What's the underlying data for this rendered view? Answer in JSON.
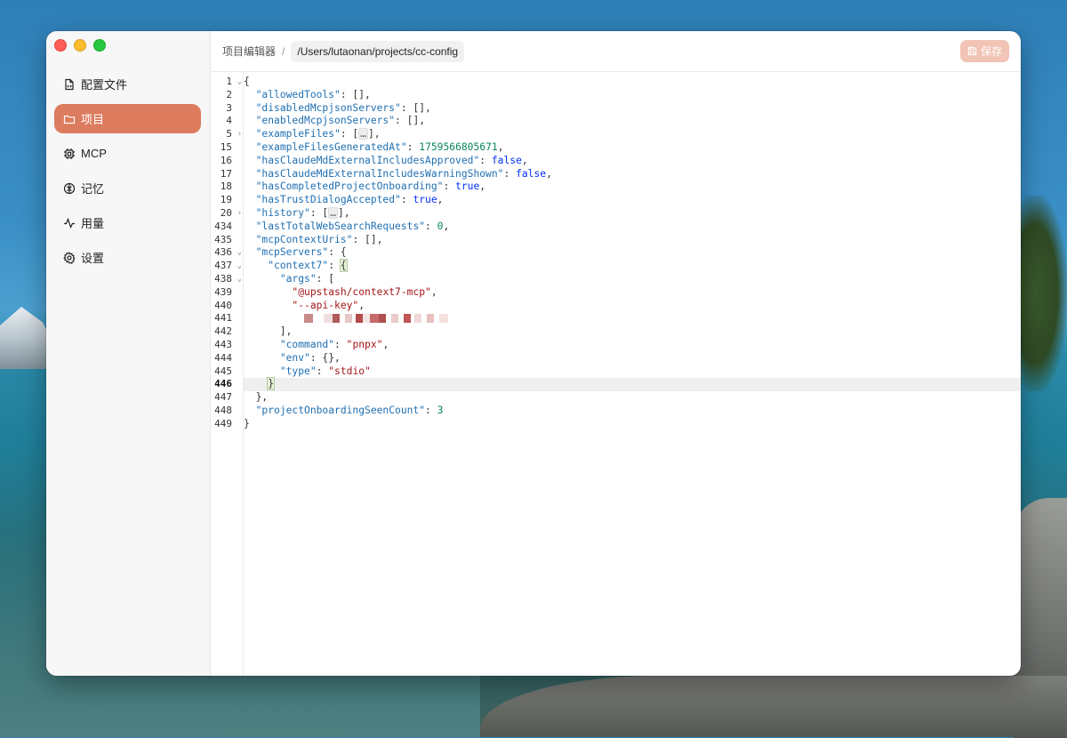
{
  "sidebar": {
    "items": [
      {
        "label": "配置文件",
        "icon": "file-code-icon",
        "active": false
      },
      {
        "label": "项目",
        "icon": "folder-icon",
        "active": true
      },
      {
        "label": "MCP",
        "icon": "chip-icon",
        "active": false
      },
      {
        "label": "记忆",
        "icon": "brain-icon",
        "active": false
      },
      {
        "label": "用量",
        "icon": "activity-icon",
        "active": false
      },
      {
        "label": "设置",
        "icon": "gear-icon",
        "active": false
      }
    ]
  },
  "header": {
    "breadcrumb": "项目编辑器",
    "separator": "/",
    "path": "/Users/lutaonan/projects/cc-config",
    "save_label": "保存"
  },
  "editor": {
    "current_line": "446",
    "lines": [
      {
        "num": "1",
        "fold": "open",
        "tokens": [
          [
            "p",
            "{"
          ]
        ]
      },
      {
        "num": "2",
        "tokens": [
          [
            "p",
            "  "
          ],
          [
            "k",
            "\"allowedTools\""
          ],
          [
            "p",
            ": [],"
          ]
        ]
      },
      {
        "num": "3",
        "tokens": [
          [
            "p",
            "  "
          ],
          [
            "k",
            "\"disabledMcpjsonServers\""
          ],
          [
            "p",
            ": [],"
          ]
        ]
      },
      {
        "num": "4",
        "tokens": [
          [
            "p",
            "  "
          ],
          [
            "k",
            "\"enabledMcpjsonServers\""
          ],
          [
            "p",
            ": [],"
          ]
        ]
      },
      {
        "num": "5",
        "fold": "closed",
        "tokens": [
          [
            "p",
            "  "
          ],
          [
            "k",
            "\"exampleFiles\""
          ],
          [
            "p",
            ": ["
          ],
          [
            "e",
            "…"
          ],
          [
            "p",
            "],"
          ]
        ]
      },
      {
        "num": "15",
        "tokens": [
          [
            "p",
            "  "
          ],
          [
            "k",
            "\"exampleFilesGeneratedAt\""
          ],
          [
            "p",
            ": "
          ],
          [
            "n",
            "1759566805671"
          ],
          [
            "p",
            ","
          ]
        ]
      },
      {
        "num": "16",
        "tokens": [
          [
            "p",
            "  "
          ],
          [
            "k",
            "\"hasClaudeMdExternalIncludesApproved\""
          ],
          [
            "p",
            ": "
          ],
          [
            "b",
            "false"
          ],
          [
            "p",
            ","
          ]
        ]
      },
      {
        "num": "17",
        "tokens": [
          [
            "p",
            "  "
          ],
          [
            "k",
            "\"hasClaudeMdExternalIncludesWarningShown\""
          ],
          [
            "p",
            ": "
          ],
          [
            "b",
            "false"
          ],
          [
            "p",
            ","
          ]
        ]
      },
      {
        "num": "18",
        "tokens": [
          [
            "p",
            "  "
          ],
          [
            "k",
            "\"hasCompletedProjectOnboarding\""
          ],
          [
            "p",
            ": "
          ],
          [
            "b",
            "true"
          ],
          [
            "p",
            ","
          ]
        ]
      },
      {
        "num": "19",
        "tokens": [
          [
            "p",
            "  "
          ],
          [
            "k",
            "\"hasTrustDialogAccepted\""
          ],
          [
            "p",
            ": "
          ],
          [
            "b",
            "true"
          ],
          [
            "p",
            ","
          ]
        ]
      },
      {
        "num": "20",
        "fold": "closed",
        "tokens": [
          [
            "p",
            "  "
          ],
          [
            "k",
            "\"history\""
          ],
          [
            "p",
            ": ["
          ],
          [
            "e",
            "…"
          ],
          [
            "p",
            "],"
          ]
        ]
      },
      {
        "num": "434",
        "tokens": [
          [
            "p",
            "  "
          ],
          [
            "k",
            "\"lastTotalWebSearchRequests\""
          ],
          [
            "p",
            ": "
          ],
          [
            "n",
            "0"
          ],
          [
            "p",
            ","
          ]
        ]
      },
      {
        "num": "435",
        "tokens": [
          [
            "p",
            "  "
          ],
          [
            "k",
            "\"mcpContextUris\""
          ],
          [
            "p",
            ": [],"
          ]
        ]
      },
      {
        "num": "436",
        "fold": "open",
        "tokens": [
          [
            "p",
            "  "
          ],
          [
            "k",
            "\"mcpServers\""
          ],
          [
            "p",
            ": {"
          ]
        ]
      },
      {
        "num": "437",
        "fold": "open",
        "tokens": [
          [
            "p",
            "    "
          ],
          [
            "k",
            "\"context7\""
          ],
          [
            "p",
            ": "
          ],
          [
            "h",
            "{"
          ]
        ]
      },
      {
        "num": "438",
        "fold": "open",
        "tokens": [
          [
            "p",
            "      "
          ],
          [
            "k",
            "\"args\""
          ],
          [
            "p",
            ": ["
          ]
        ]
      },
      {
        "num": "439",
        "tokens": [
          [
            "p",
            "        "
          ],
          [
            "s",
            "\"@upstash/context7-mcp\""
          ],
          [
            "p",
            ","
          ]
        ]
      },
      {
        "num": "440",
        "tokens": [
          [
            "p",
            "        "
          ],
          [
            "s",
            "\"--api-key\""
          ],
          [
            "p",
            ","
          ]
        ]
      },
      {
        "num": "441",
        "tokens": [
          [
            "p",
            "          "
          ],
          [
            "r",
            ""
          ]
        ]
      },
      {
        "num": "442",
        "tokens": [
          [
            "p",
            "      ],"
          ]
        ]
      },
      {
        "num": "443",
        "tokens": [
          [
            "p",
            "      "
          ],
          [
            "k",
            "\"command\""
          ],
          [
            "p",
            ": "
          ],
          [
            "s",
            "\"pnpx\""
          ],
          [
            "p",
            ","
          ]
        ]
      },
      {
        "num": "444",
        "tokens": [
          [
            "p",
            "      "
          ],
          [
            "k",
            "\"env\""
          ],
          [
            "p",
            ": {},"
          ]
        ]
      },
      {
        "num": "445",
        "tokens": [
          [
            "p",
            "      "
          ],
          [
            "k",
            "\"type\""
          ],
          [
            "p",
            ": "
          ],
          [
            "s",
            "\"stdio\""
          ]
        ]
      },
      {
        "num": "446",
        "tokens": [
          [
            "p",
            "    "
          ],
          [
            "h",
            "}"
          ]
        ]
      },
      {
        "num": "447",
        "tokens": [
          [
            "p",
            "  },"
          ]
        ]
      },
      {
        "num": "448",
        "tokens": [
          [
            "p",
            "  "
          ],
          [
            "k",
            "\"projectOnboardingSeenCount\""
          ],
          [
            "p",
            ": "
          ],
          [
            "n",
            "3"
          ]
        ]
      },
      {
        "num": "449",
        "tokens": [
          [
            "p",
            "}"
          ]
        ]
      }
    ]
  },
  "colors": {
    "accent": "#dd7b5e",
    "save_disabled": "#f1c4b6",
    "json_key": "#1f6fb2",
    "json_string": "#a31515",
    "json_number": "#098658",
    "json_boolean": "#0431fa"
  }
}
